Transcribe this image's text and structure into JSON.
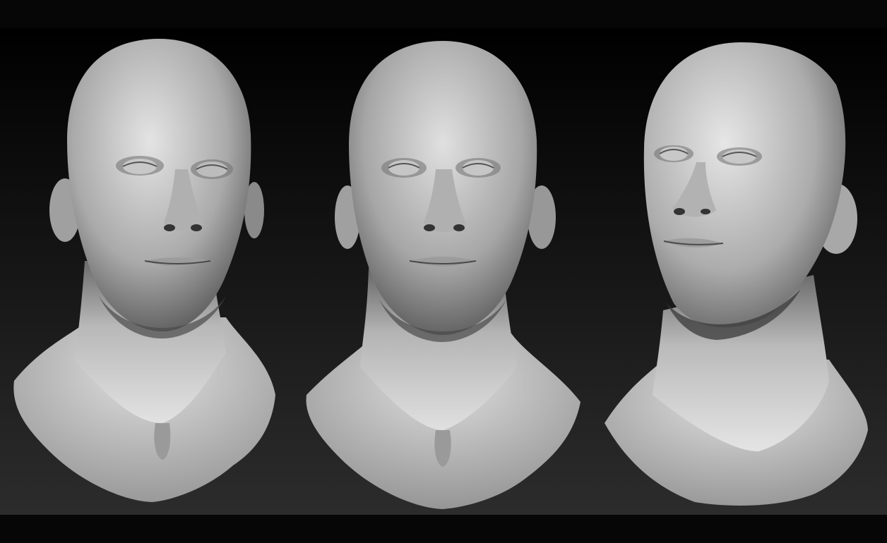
{
  "scene": {
    "subject": "sculpted-bald-male-head",
    "views": [
      "front-left",
      "front",
      "three-quarter-up"
    ],
    "colors": {
      "background_top": "#000000",
      "background_bottom": "#2c2c2c",
      "clay_light": "#e4e4e4",
      "clay_mid": "#a8a8a8",
      "clay_dark": "#4a4a4a",
      "bar": "#060606"
    }
  }
}
